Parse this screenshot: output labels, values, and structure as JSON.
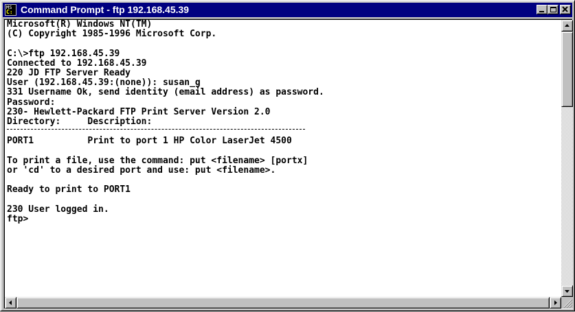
{
  "window": {
    "title": "Command Prompt - ftp 192.168.45.39",
    "icon": {
      "name": "ms-dos-icon",
      "top_text": "MS",
      "bottom_text": "C:"
    },
    "controls": [
      "minimize-icon",
      "maximize-icon",
      "close-icon"
    ]
  },
  "console": {
    "lines": [
      "Microsoft(R) Windows NT(TM)",
      "(C) Copyright 1985-1996 Microsoft Corp.",
      "",
      "C:\\>ftp 192.168.45.39",
      "Connected to 192.168.45.39",
      "220 JD FTP Server Ready",
      "User (192.168.45.39:(none)): susan_g",
      "331 Username Ok, send identity (email address) as password.",
      "Password:",
      "230- Hewlett-Packard FTP Print Server Version 2.0",
      "Directory:     Description:",
      "",
      "PORT1          Print to port 1 HP Color LaserJet 4500",
      "",
      "To print a file, use the command: put <filename> [portx]",
      "or 'cd' to a desired port and use: put <filename>.",
      "",
      "Ready to print to PORT1",
      "",
      "230 User logged in.",
      "ftp>"
    ]
  },
  "colors": {
    "titlebar": "#000080",
    "face": "#c0c0c0",
    "console_bg": "#ffffff",
    "console_text": "#000000"
  }
}
